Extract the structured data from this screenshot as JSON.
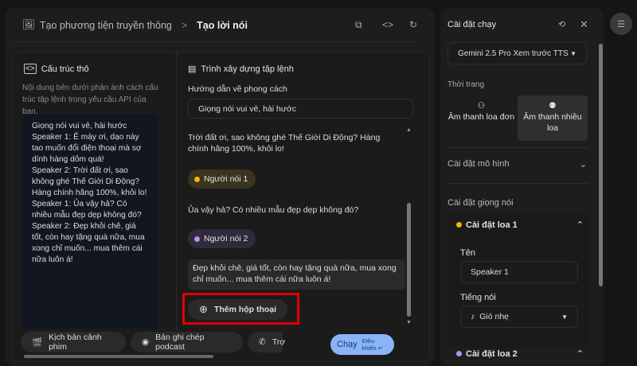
{
  "header": {
    "breadcrumb_parent": "Tạo phương tiện truyền thông",
    "breadcrumb_sep": ">",
    "breadcrumb_current": "Tạo lời nói"
  },
  "raw": {
    "title": "Cấu trúc thô",
    "description": "Nội dung bên dưới phản ánh cách cấu trúc tập lệnh trong yêu cầu API của bạn.",
    "content": "Giọng nói vui vẻ, hài hước\nSpeaker 1: Ê mày ơi, dạo này tao muốn đổi điện thoại mà sợ dính hàng dỏm quá!\nSpeaker 2: Trời đất ơi, sao không ghé Thế Giới Di Động? Hàng chính hãng 100%, khỏi lo!\nSpeaker 1: Ủa vậy hả? Có nhiều mẫu đẹp dẹp không đó?\nSpeaker 2: Đẹp khỏi chê, giá tốt, còn hay tặng quà nữa, mua xong chỉ muốn... mua thêm cái nữa luôn á!"
  },
  "builder": {
    "title": "Trình xây dựng tập lệnh",
    "style_label": "Hướng dẫn về phong cách",
    "style_value": "Giọng nói vui vẻ, hài hước",
    "line1": "Trời đất ơi, sao không ghé Thế Giới Di Động? Hàng chính hãng 100%, khỏi lo!",
    "speaker1": "Người nói 1",
    "line2": "Ủa vậy hả? Có nhiều mẫu đẹp dẹp không đó?",
    "speaker2": "Người nói 2",
    "line3": "Đẹp khỏi chê, giá tốt, còn hay tặng quà nữa, mua xong chỉ muốn... mua thêm cái nữa luôn á!",
    "add_dialog": "Thêm hộp thoại"
  },
  "templates": [
    "Kịch bản cảnh phim",
    "Bản ghi chép podcast",
    "Trợ"
  ],
  "run": {
    "label": "Chạy",
    "shortcut": "Điều khiển ↵"
  },
  "side": {
    "title": "Cài đặt chạy",
    "model": "Gemini 2.5 Pro Xem trước TTS",
    "mode_label": "Thời trang",
    "mode_single": "Âm thanh loa đơn",
    "mode_multi": "Âm thanh nhiều loa",
    "model_settings": "Cài đặt mô hình",
    "voice_settings": "Cài đặt giọng nói",
    "speaker1": {
      "title": "Cài đặt loa 1",
      "name_label": "Tên",
      "name_value": "Speaker 1",
      "voice_label": "Tiếng nói",
      "voice_value": "Gió nhẹ"
    },
    "speaker2": {
      "title": "Cài đặt loa 2"
    }
  },
  "colors": {
    "speaker1": "#f4b400",
    "speaker2": "#b592f5",
    "run": "#8ab4f8",
    "highlight": "#e00000"
  }
}
